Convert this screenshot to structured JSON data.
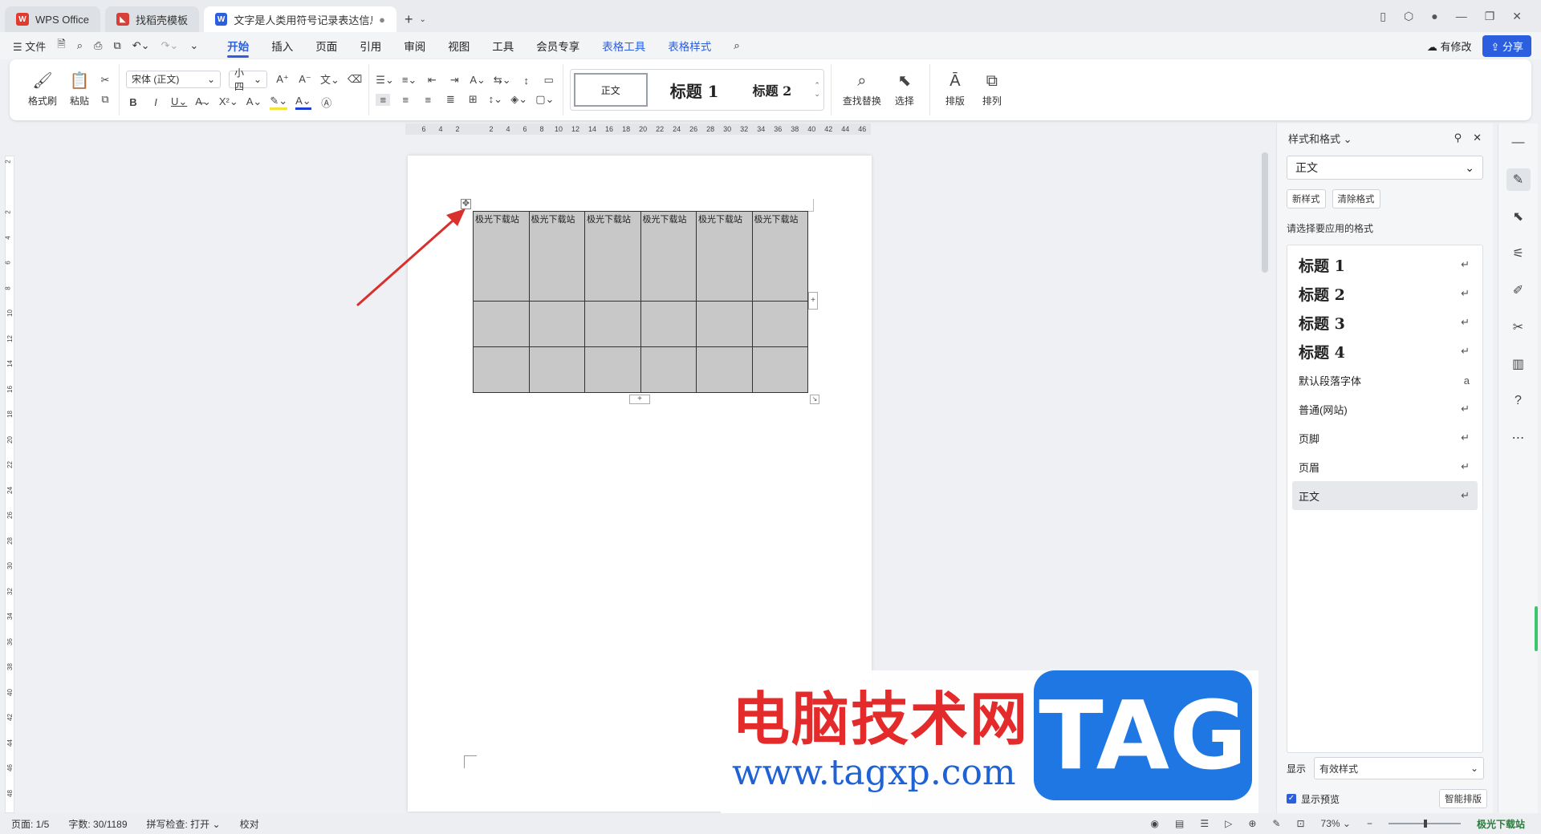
{
  "tabs": [
    {
      "label": "WPS Office",
      "logo": "W",
      "kind": "wps"
    },
    {
      "label": "找稻壳模板",
      "logo": "◣",
      "kind": "tpl"
    },
    {
      "label": "文字是人类用符号记录表达信息以",
      "logo": "W",
      "kind": "doc"
    }
  ],
  "menu": {
    "file_label": "文件",
    "tabs": [
      "开始",
      "插入",
      "页面",
      "引用",
      "审阅",
      "视图",
      "工具",
      "会员专享"
    ],
    "context_tabs": [
      "表格工具",
      "表格样式"
    ],
    "modified_label": "有修改",
    "share_label": "分享"
  },
  "ribbon": {
    "format_painter": "格式刷",
    "paste": "粘贴",
    "font_name": "宋体 (正文)",
    "font_size": "小四",
    "styles": [
      "正文",
      "标题 1",
      "标题 2"
    ],
    "find_replace": "查找替换",
    "select": "选择",
    "layout": "排版",
    "arrange": "排列"
  },
  "ruler": {
    "h_ticks": [
      "6",
      "4",
      "2",
      "",
      "2",
      "4",
      "6",
      "8",
      "10",
      "12",
      "14",
      "16",
      "18",
      "20",
      "22",
      "24",
      "26",
      "28",
      "30",
      "32",
      "34",
      "36",
      "38",
      "40",
      "42",
      "44",
      "46"
    ],
    "v_ticks": [
      "2",
      "",
      "2",
      "4",
      "6",
      "8",
      "10",
      "12",
      "14",
      "16",
      "18",
      "20",
      "22",
      "24",
      "26",
      "28",
      "30",
      "32",
      "34",
      "36",
      "38",
      "40",
      "42",
      "44",
      "46",
      "48"
    ]
  },
  "table": {
    "header": [
      "极光下载站",
      "极光下载站",
      "极光下载站",
      "极光下载站",
      "极光下载站",
      "极光下载站"
    ],
    "rows": [
      [
        "",
        "",
        "",
        "",
        "",
        ""
      ],
      [
        "",
        "",
        "",
        "",
        "",
        ""
      ]
    ]
  },
  "panel": {
    "title": "样式和格式",
    "current_style": "正文",
    "new_style": "新样式",
    "clear_format": "清除格式",
    "hint": "请选择要应用的格式",
    "styles": [
      {
        "name": "标题 1",
        "heading": true,
        "mark": "↵"
      },
      {
        "name": "标题 2",
        "heading": true,
        "mark": "↵"
      },
      {
        "name": "标题 3",
        "heading": true,
        "mark": "↵"
      },
      {
        "name": "标题 4",
        "heading": true,
        "mark": "↵"
      },
      {
        "name": "默认段落字体",
        "heading": false,
        "mark": "a"
      },
      {
        "name": "普通(网站)",
        "heading": false,
        "mark": "↵"
      },
      {
        "name": "页脚",
        "heading": false,
        "mark": "↵"
      },
      {
        "name": "页眉",
        "heading": false,
        "mark": "↵"
      },
      {
        "name": "正文",
        "heading": false,
        "mark": "↵",
        "selected": true
      }
    ],
    "show_label": "显示",
    "show_value": "有效样式",
    "preview_label": "显示预览",
    "smart_layout": "智能排版"
  },
  "status": {
    "page": "页面: 1/5",
    "words": "字数: 30/1189",
    "spell": "拼写检查: 打开",
    "proof": "校对",
    "zoom": "73%"
  },
  "watermark": {
    "text": "电脑技术网",
    "url": "www.tagxp.com",
    "tag": "TAG",
    "corner": "极光下载站"
  },
  "colors": {
    "accent": "#2b5fe0",
    "table_fill": "#c8c8c8",
    "arrow": "#d9302c"
  }
}
